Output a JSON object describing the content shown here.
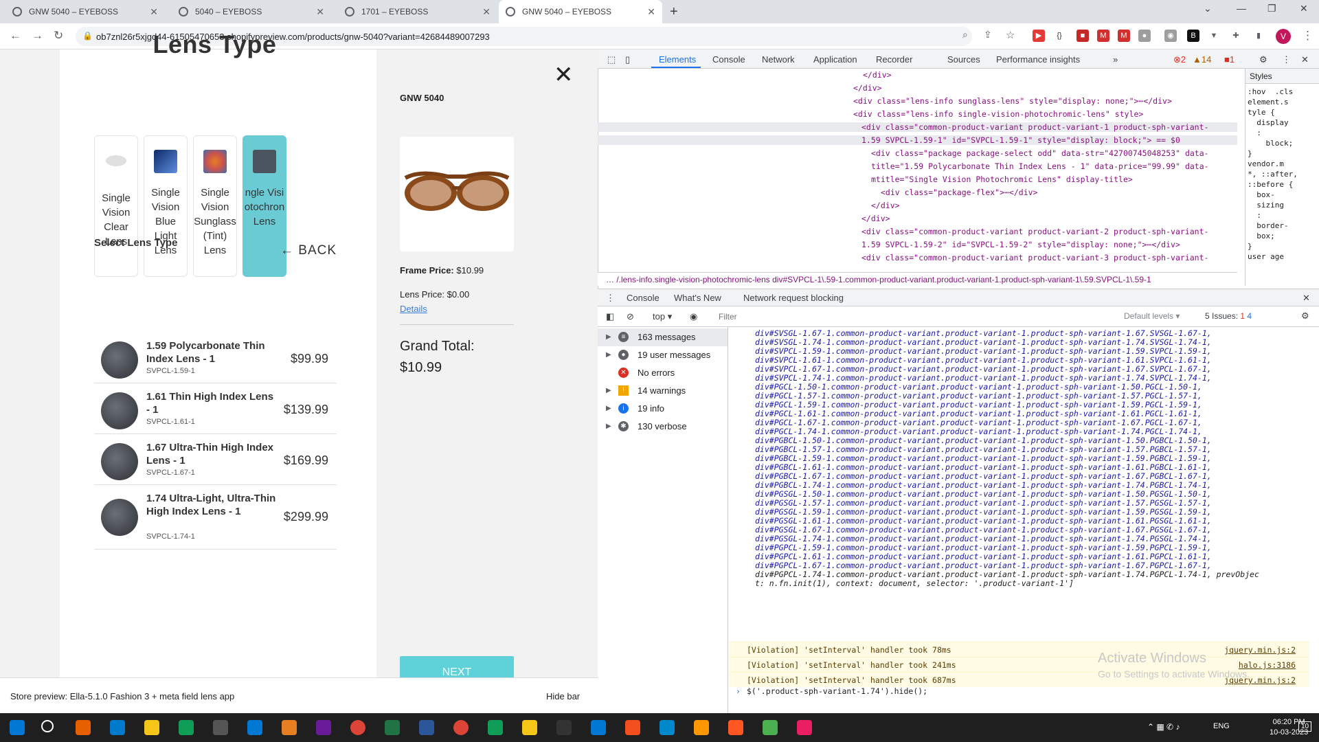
{
  "browser": {
    "tabs": [
      {
        "title": "GNW 5040 – EYEBOSS"
      },
      {
        "title": "5040 – EYEBOSS"
      },
      {
        "title": "1701 – EYEBOSS"
      },
      {
        "title": "GNW 5040 – EYEBOSS",
        "active": true
      }
    ],
    "url": "ob7znl26r5xjgd44-61505470653.shopifypreview.com/products/gnw-5040?variant=42684489007293"
  },
  "page": {
    "title": "Lens Type",
    "lens_types": [
      {
        "label": "Single\nVision\nClear\nLens",
        "color": "#cfcfcf"
      },
      {
        "label": "Single\nVision\nBlue\nLight\nLens",
        "color": "#0d2a66"
      },
      {
        "label": "Single\nVision\nSunglass\n(Tint)\nLens",
        "color": "#c9534f"
      },
      {
        "label": "ngle Visi\notochron\nLens",
        "color": "#4b5560",
        "active": true
      }
    ],
    "select_label": "Select Lens Type",
    "back_label": "BACK",
    "products": [
      {
        "name": "1.59 Polycarbonate Thin Index Lens - 1",
        "sku": "SVPCL-1.59-1",
        "price": "$99.99"
      },
      {
        "name": "1.61 Thin High Index Lens - 1",
        "sku": "SVPCL-1.61-1",
        "price": "$139.99"
      },
      {
        "name": "1.67 Ultra-Thin High Index Lens - 1",
        "sku": "SVPCL-1.67-1",
        "price": "$169.99"
      },
      {
        "name": "1.74 Ultra-Light, Ultra-Thin High Index Lens - 1",
        "sku": "SVPCL-1.74-1",
        "price": "$299.99"
      }
    ],
    "product_code": "GNW 5040",
    "frame_price_label": "Frame Price:",
    "frame_price": "$10.99",
    "lens_price_label": "Lens Price: $0.00",
    "details_link": "Details",
    "grand_total_label": "Grand Total:",
    "grand_total": "$10.99",
    "next_label": "NEXT",
    "preview_text": "Store preview: Ella-5.1.0 Fashion 3 + meta field lens app",
    "hide_bar": "Hide bar"
  },
  "devtools": {
    "tabs": [
      "Elements",
      "Console",
      "Network",
      "Application",
      "Recorder",
      "Sources",
      "Performance insights"
    ],
    "active_tab": "Elements",
    "badges": {
      "errors": "2",
      "warnings": "14",
      "issues": "1"
    },
    "elements_lines": [
      "</div>",
      "</div>",
      "<div class=\"lens-info sunglass-lens\" style=\"display: none;\">⋯</div>",
      "<div class=\"lens-info single-vision-photochromic-lens\" style>",
      "<div class=\"common-product-variant product-variant-1 product-sph-variant-",
      "1.59 SVPCL-1.59-1\" id=\"SVPCL-1.59-1\" style=\"display: block;\"> == $0",
      "<div class=\"package package-select odd\" data-str=\"42700745048253\" data-",
      "title=\"1.59 Polycarbonate Thin Index Lens - 1\" data-price=\"99.99\" data-",
      "mtitle=\"Single Vision Photochromic Lens\" display-title>",
      "<div class=\"package-flex\">⋯</div>",
      "</div>",
      "</div>",
      "<div class=\"common-product-variant product-variant-2 product-sph-variant-",
      "1.59 SVPCL-1.59-2\" id=\"SVPCL-1.59-2\" style=\"display: none;\">⋯</div>",
      "<div class=\"common-product-variant product-variant-3 product-sph-variant-"
    ],
    "breadcrumb": "… /.lens-info.single-vision-photochromic-lens    div#SVPCL-1\\.59-1.common-product-variant.product-variant-1.product-sph-variant-1\\.59.SVPCL-1\\.59-1",
    "styles_tab": "Styles",
    "styles_lines": [
      ":hov  .cls",
      "element.s",
      "tyle {",
      "  display",
      "  :",
      "    block;",
      "}",
      "vendor.m",
      "*, ::after,",
      "::before {",
      "  box-",
      "  sizing",
      "  :",
      "  border-",
      "  box;",
      "}",
      "user age"
    ],
    "console_tabs": [
      "Console",
      "What's New",
      "Network request blocking"
    ],
    "context": "top",
    "filter_placeholder": "Filter",
    "levels": "Default levels",
    "issues": "5 Issues:",
    "issues_counts": {
      "errors": "1",
      "info": "4"
    },
    "sidebar": [
      {
        "label": "163 messages",
        "icon": "list-icon",
        "color": "#5f6368"
      },
      {
        "label": "19 user messages",
        "icon": "user-icon",
        "color": "#5f6368"
      },
      {
        "label": "No errors",
        "icon": "error-icon",
        "color": "#d93025"
      },
      {
        "label": "14 warnings",
        "icon": "warning-icon",
        "color": "#f2a600"
      },
      {
        "label": "19 info",
        "icon": "info-icon",
        "color": "#1a73e8"
      },
      {
        "label": "130 verbose",
        "icon": "bug-icon",
        "color": "#5f6368"
      }
    ],
    "console_lines": [
      "div#SVSGL-1.67-1.common-product-variant.product-variant-1.product-sph-variant-1.67.SVSGL-1.67-1,",
      "div#SVSGL-1.74-1.common-product-variant.product-variant-1.product-sph-variant-1.74.SVSGL-1.74-1,",
      "div#SVPCL-1.59-1.common-product-variant.product-variant-1.product-sph-variant-1.59.SVPCL-1.59-1,",
      "div#SVPCL-1.61-1.common-product-variant.product-variant-1.product-sph-variant-1.61.SVPCL-1.61-1,",
      "div#SVPCL-1.67-1.common-product-variant.product-variant-1.product-sph-variant-1.67.SVPCL-1.67-1,",
      "div#SVPCL-1.74-1.common-product-variant.product-variant-1.product-sph-variant-1.74.SVPCL-1.74-1,",
      "div#PGCL-1.50-1.common-product-variant.product-variant-1.product-sph-variant-1.50.PGCL-1.50-1,",
      "div#PGCL-1.57-1.common-product-variant.product-variant-1.product-sph-variant-1.57.PGCL-1.57-1,",
      "div#PGCL-1.59-1.common-product-variant.product-variant-1.product-sph-variant-1.59.PGCL-1.59-1,",
      "div#PGCL-1.61-1.common-product-variant.product-variant-1.product-sph-variant-1.61.PGCL-1.61-1,",
      "div#PGCL-1.67-1.common-product-variant.product-variant-1.product-sph-variant-1.67.PGCL-1.67-1,",
      "div#PGCL-1.74-1.common-product-variant.product-variant-1.product-sph-variant-1.74.PGCL-1.74-1,",
      "div#PGBCL-1.50-1.common-product-variant.product-variant-1.product-sph-variant-1.50.PGBCL-1.50-1,",
      "div#PGBCL-1.57-1.common-product-variant.product-variant-1.product-sph-variant-1.57.PGBCL-1.57-1,",
      "div#PGBCL-1.59-1.common-product-variant.product-variant-1.product-sph-variant-1.59.PGBCL-1.59-1,",
      "div#PGBCL-1.61-1.common-product-variant.product-variant-1.product-sph-variant-1.61.PGBCL-1.61-1,",
      "div#PGBCL-1.67-1.common-product-variant.product-variant-1.product-sph-variant-1.67.PGBCL-1.67-1,",
      "div#PGBCL-1.74-1.common-product-variant.product-variant-1.product-sph-variant-1.74.PGBCL-1.74-1,",
      "div#PGSGL-1.50-1.common-product-variant.product-variant-1.product-sph-variant-1.50.PGSGL-1.50-1,",
      "div#PGSGL-1.57-1.common-product-variant.product-variant-1.product-sph-variant-1.57.PGSGL-1.57-1,",
      "div#PGSGL-1.59-1.common-product-variant.product-variant-1.product-sph-variant-1.59.PGSGL-1.59-1,",
      "div#PGSGL-1.61-1.common-product-variant.product-variant-1.product-sph-variant-1.61.PGSGL-1.61-1,",
      "div#PGSGL-1.67-1.common-product-variant.product-variant-1.product-sph-variant-1.67.PGSGL-1.67-1,",
      "div#PGSGL-1.74-1.common-product-variant.product-variant-1.product-sph-variant-1.74.PGSGL-1.74-1,",
      "div#PGPCL-1.59-1.common-product-variant.product-variant-1.product-sph-variant-1.59.PGPCL-1.59-1,",
      "div#PGPCL-1.61-1.common-product-variant.product-variant-1.product-sph-variant-1.61.PGPCL-1.61-1,",
      "div#PGPCL-1.67-1.common-product-variant.product-variant-1.product-sph-variant-1.67.PGPCL-1.67-1,",
      "div#PGPCL-1.74-1.common-product-variant.product-variant-1.product-sph-variant-1.74.PGPCL-1.74-1, prevObjec",
      "t: n.fn.init(1), context: document, selector: '.product-variant-1']"
    ],
    "violations": [
      {
        "text": "[Violation] 'setInterval' handler took 78ms",
        "src": "jquery.min.js:2"
      },
      {
        "text": "[Violation] 'setInterval' handler took 241ms",
        "src": "halo.js:3186"
      },
      {
        "text": "[Violation] 'setInterval' handler took 687ms",
        "src": "jquery.min.js:2"
      }
    ],
    "prompt": "$('.product-sph-variant-1.74').hide();",
    "watermark_title": "Activate Windows",
    "watermark_sub": "Go to Settings to activate Windows."
  },
  "taskbar": {
    "time": "06:20 PM",
    "date": "10-03-2023",
    "lang": "ENG",
    "notif": "10"
  }
}
